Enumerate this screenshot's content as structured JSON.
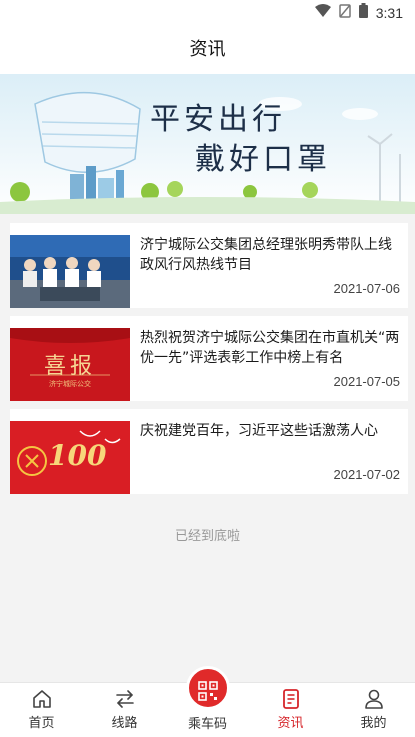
{
  "status_bar": {
    "time": "3:31"
  },
  "header": {
    "title": "资讯"
  },
  "banner": {
    "slogan_line1": "平安出行",
    "slogan_line2": "戴好口罩"
  },
  "news": [
    {
      "title": "济宁城际公交集团总经理张明秀带队上线政风行风热线节目",
      "date": "2021-07-06"
    },
    {
      "title": "热烈祝贺济宁城际公交集团在市直机关“两优一先”评选表彰工作中榜上有名",
      "date": "2021-07-05",
      "thumb_text": "喜报",
      "thumb_sub": "济宁城际公交"
    },
    {
      "title": "庆祝建党百年，习近平这些话激荡人心",
      "date": "2021-07-02",
      "thumb_text": "100"
    }
  ],
  "end_text": "已经到底啦",
  "tabs": [
    {
      "label": "首页",
      "icon": "home-icon"
    },
    {
      "label": "线路",
      "icon": "route-icon"
    },
    {
      "label": "乘车码",
      "icon": "qrcode-icon"
    },
    {
      "label": "资讯",
      "icon": "news-icon",
      "active": true
    },
    {
      "label": "我的",
      "icon": "user-icon"
    }
  ],
  "colors": {
    "accent": "#d6262b",
    "center_button": "#e02a2a"
  }
}
